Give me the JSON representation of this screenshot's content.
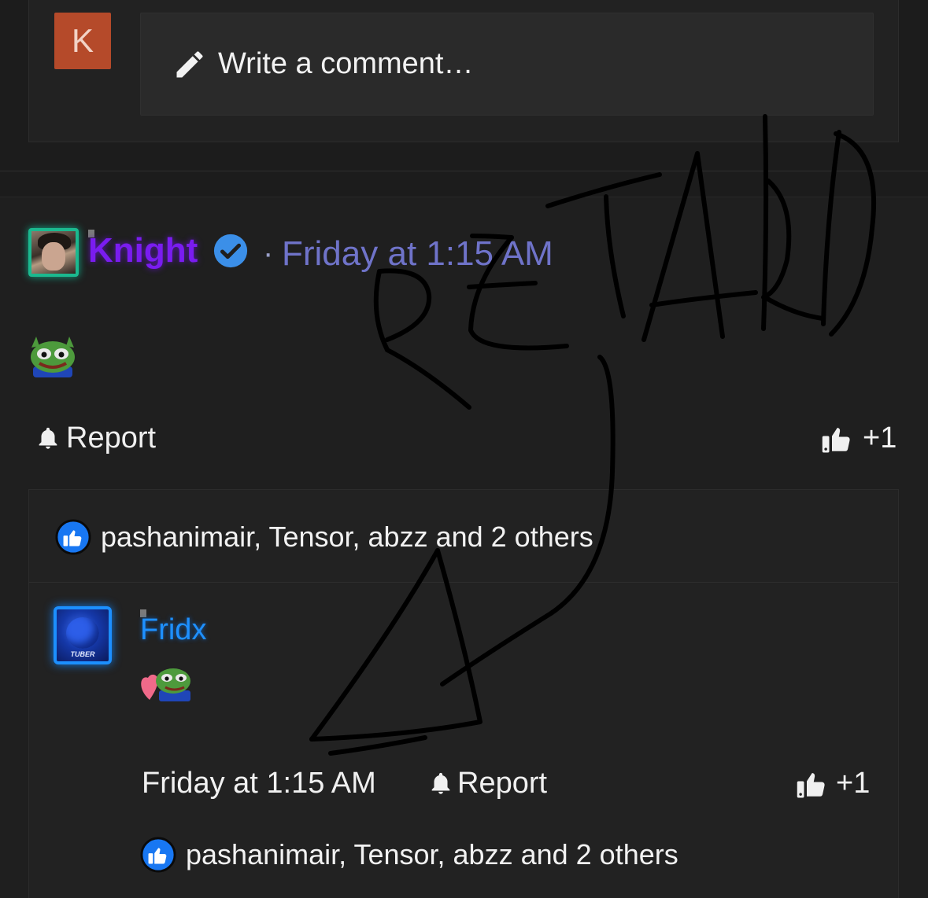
{
  "composer": {
    "avatar_letter": "K",
    "placeholder": "Write a comment…"
  },
  "post": {
    "author": "Knight",
    "separator": "·",
    "timestamp": "Friday at 1:15 AM",
    "report_label": "Report",
    "like_label": "+1",
    "likers_text": "pashanimair, Tensor, abzz and 2 others"
  },
  "reply": {
    "author": "Fridx",
    "avatar_tag": "TUBER",
    "timestamp": "Friday at 1:15 AM",
    "report_label": "Report",
    "like_label": "+1",
    "likers_text": "pashanimair, Tensor, abzz and 2 others"
  },
  "colors": {
    "background": "#1c1c1c",
    "knight_name": "#7a1cf0",
    "timestamp_link": "#6f73c9",
    "fridx_name": "#1e90ff",
    "like_badge": "#1877f2",
    "avatar_k": "#b54a2a"
  },
  "icons": {
    "composer": "pencil-icon",
    "verified": "verified-check-icon",
    "report": "bell-icon",
    "like": "thumbs-up-icon",
    "reaction": "like-badge-icon"
  }
}
